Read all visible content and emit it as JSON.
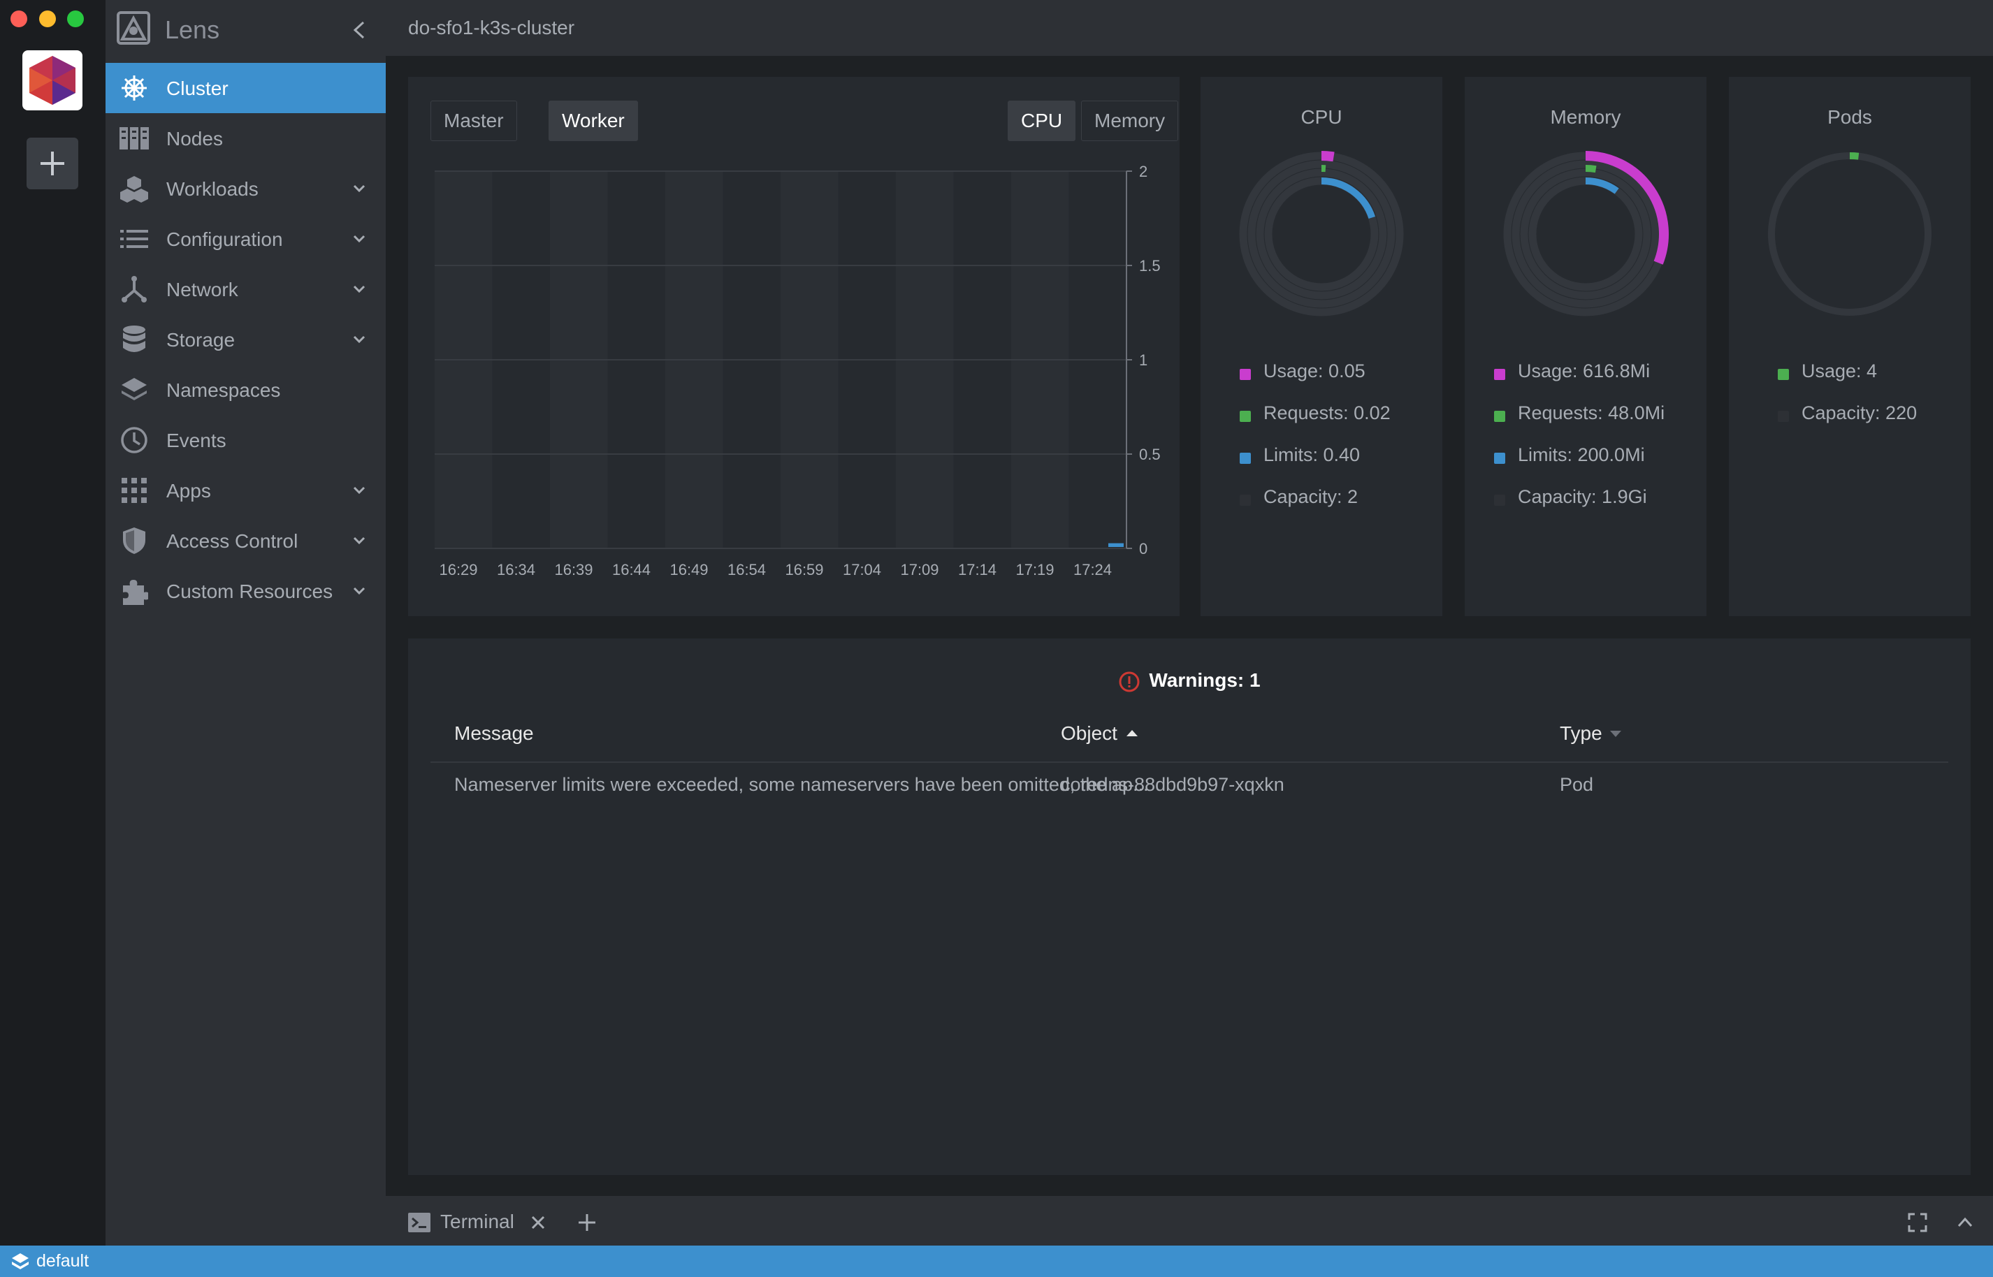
{
  "app": {
    "title": "Lens",
    "cluster_name": "do-sfo1-k3s-cluster"
  },
  "sidebar": {
    "items": [
      {
        "label": "Cluster",
        "icon": "helm-wheel-icon",
        "active": true,
        "expandable": false
      },
      {
        "label": "Nodes",
        "icon": "nodes-icon",
        "active": false,
        "expandable": false
      },
      {
        "label": "Workloads",
        "icon": "cubes-icon",
        "active": false,
        "expandable": true
      },
      {
        "label": "Configuration",
        "icon": "list-icon",
        "active": false,
        "expandable": true
      },
      {
        "label": "Network",
        "icon": "network-icon",
        "active": false,
        "expandable": true
      },
      {
        "label": "Storage",
        "icon": "database-icon",
        "active": false,
        "expandable": true
      },
      {
        "label": "Namespaces",
        "icon": "layers-icon",
        "active": false,
        "expandable": false
      },
      {
        "label": "Events",
        "icon": "clock-icon",
        "active": false,
        "expandable": false
      },
      {
        "label": "Apps",
        "icon": "grid-icon",
        "active": false,
        "expandable": true
      },
      {
        "label": "Access Control",
        "icon": "shield-icon",
        "active": false,
        "expandable": true
      },
      {
        "label": "Custom Resources",
        "icon": "puzzle-icon",
        "active": false,
        "expandable": true
      }
    ]
  },
  "metrics": {
    "node_tabs": [
      "Master",
      "Worker"
    ],
    "selected_node_tab": "Worker",
    "metric_tabs": [
      "CPU",
      "Memory"
    ],
    "selected_metric_tab": "CPU"
  },
  "chart_data": {
    "type": "bar",
    "title": "",
    "x": [
      "16:29",
      "16:34",
      "16:39",
      "16:44",
      "16:49",
      "16:54",
      "16:59",
      "17:04",
      "17:09",
      "17:14",
      "17:19",
      "17:24"
    ],
    "yticks": [
      "2",
      "1.5",
      "1",
      "0.5",
      "0"
    ],
    "ylim": [
      0,
      2
    ],
    "series": [
      {
        "name": "",
        "color": "#3d90ce",
        "values": [
          0,
          0,
          0,
          0,
          0,
          0,
          0,
          0,
          0,
          0,
          0,
          0.02
        ]
      }
    ],
    "grid": true
  },
  "gauges": [
    {
      "title": "CPU",
      "rings": [
        {
          "label": "Usage",
          "fraction": 0.025,
          "color": "#c93dce"
        },
        {
          "label": "Requests",
          "fraction": 0.01,
          "color": "#4caf50"
        },
        {
          "label": "Limits",
          "fraction": 0.2,
          "color": "#3d90ce"
        }
      ],
      "legend": [
        {
          "text": "Usage: 0.05",
          "color": "#c93dce"
        },
        {
          "text": "Requests: 0.02",
          "color": "#4caf50"
        },
        {
          "text": "Limits: 0.40",
          "color": "#3d90ce"
        },
        {
          "text": "Capacity: 2",
          "color": "#2d3035"
        }
      ]
    },
    {
      "title": "Memory",
      "rings": [
        {
          "label": "Usage",
          "fraction": 0.31,
          "color": "#c93dce"
        },
        {
          "label": "Requests",
          "fraction": 0.025,
          "color": "#4caf50"
        },
        {
          "label": "Limits",
          "fraction": 0.1,
          "color": "#3d90ce"
        }
      ],
      "legend": [
        {
          "text": "Usage: 616.8Mi",
          "color": "#c93dce"
        },
        {
          "text": "Requests: 48.0Mi",
          "color": "#4caf50"
        },
        {
          "text": "Limits: 200.0Mi",
          "color": "#3d90ce"
        },
        {
          "text": "Capacity: 1.9Gi",
          "color": "#2d3035"
        }
      ]
    },
    {
      "title": "Pods",
      "rings": [
        {
          "label": "Usage",
          "fraction": 0.018,
          "color": "#4caf50"
        }
      ],
      "legend": [
        {
          "text": "Usage: 4",
          "color": "#4caf50"
        },
        {
          "text": "Capacity: 220",
          "color": "#2d3035"
        }
      ]
    }
  ],
  "warnings": {
    "title": "Warnings: 1",
    "columns": {
      "message": "Message",
      "object": "Object",
      "type": "Type"
    },
    "rows": [
      {
        "message": "Nameserver limits were exceeded, some nameservers have been omitted, the ap...",
        "object": "coredns-88dbd9b97-xqxkn",
        "type": "Pod"
      }
    ]
  },
  "dock": {
    "terminal_label": "Terminal"
  },
  "status": {
    "namespace": "default"
  }
}
